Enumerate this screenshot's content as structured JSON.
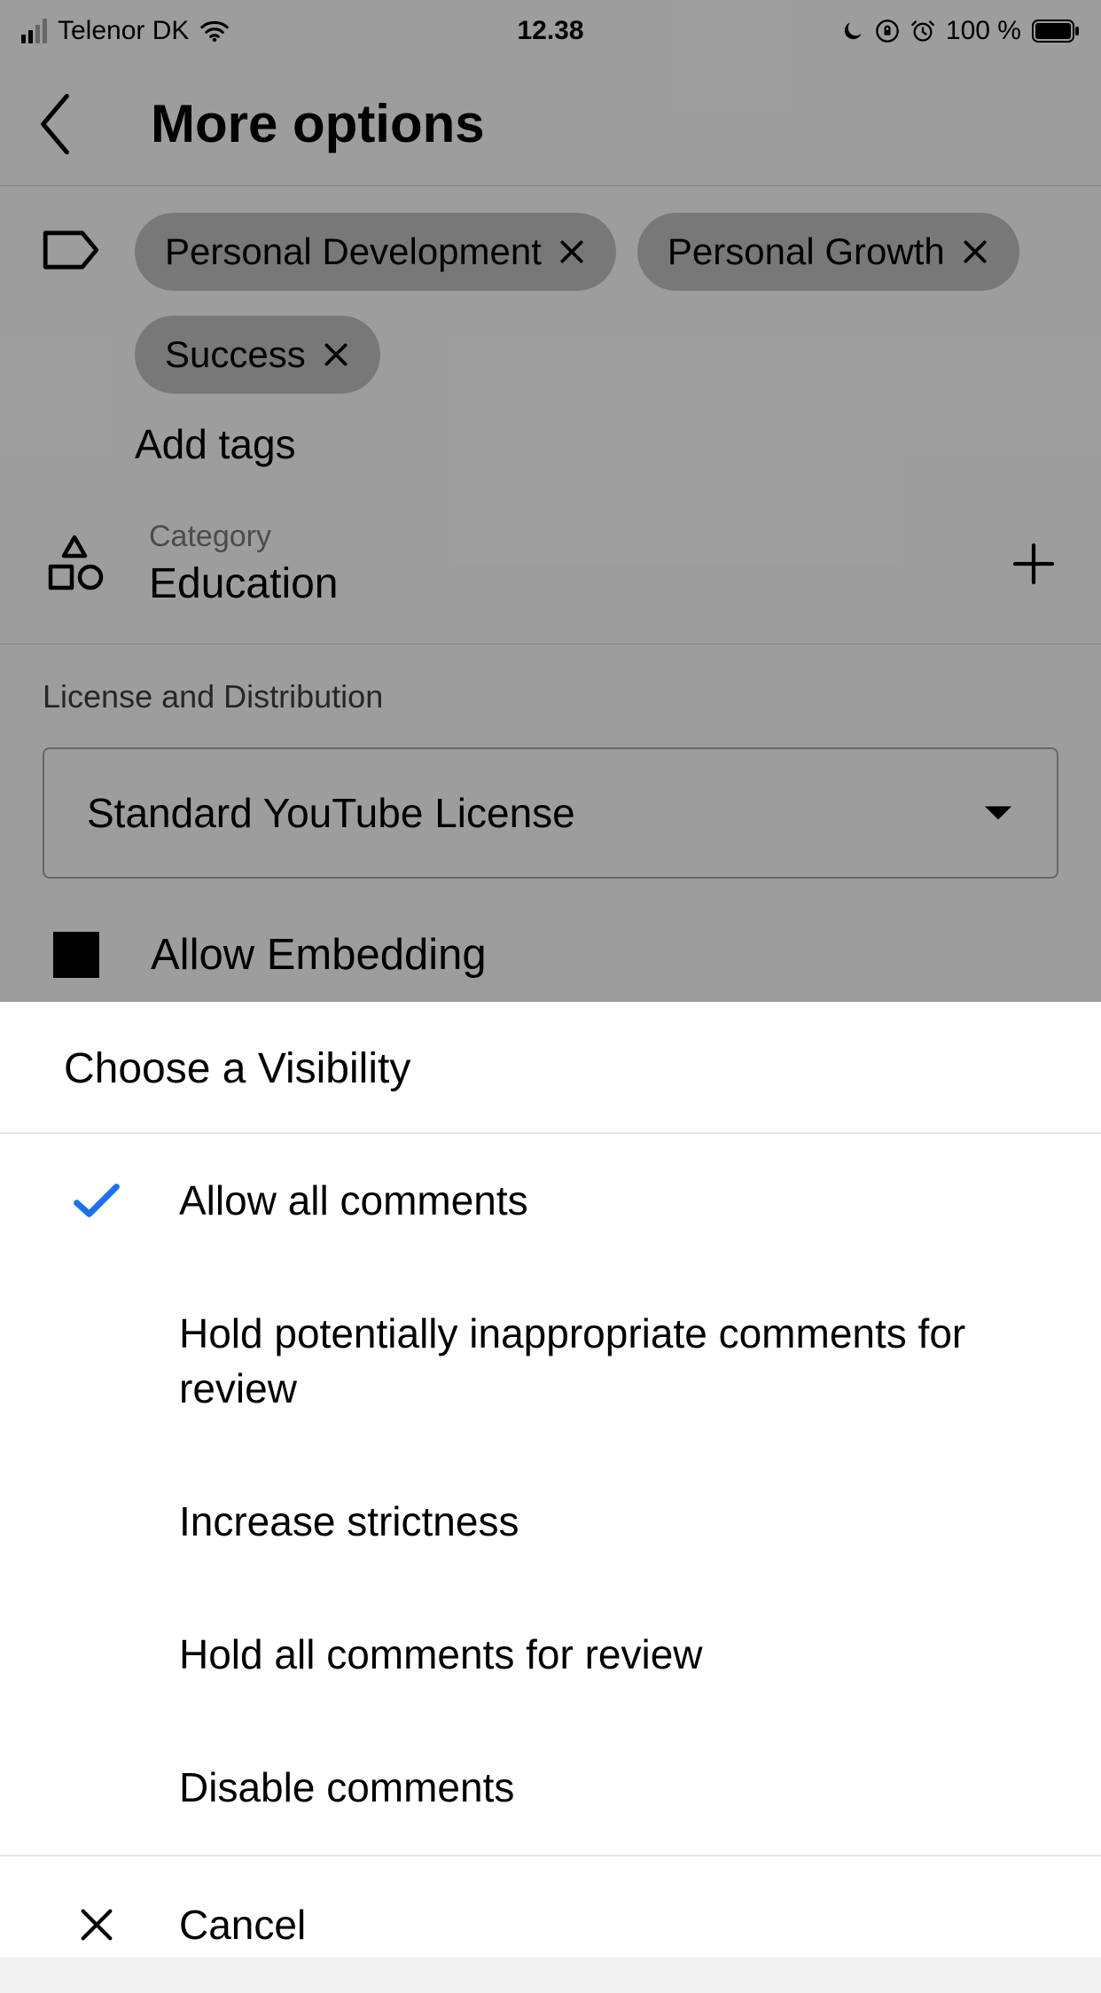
{
  "status": {
    "carrier": "Telenor DK",
    "time": "12.38",
    "battery": "100 %"
  },
  "header": {
    "title": "More options"
  },
  "tags": {
    "items": [
      {
        "label": "Personal Development"
      },
      {
        "label": "Personal Growth"
      },
      {
        "label": "Success"
      }
    ],
    "add_label": "Add tags"
  },
  "category": {
    "label": "Category",
    "value": "Education"
  },
  "license": {
    "section_label": "License and Distribution",
    "selected": "Standard YouTube License"
  },
  "allow_embedding": {
    "label": "Allow Embedding"
  },
  "sheet": {
    "title": "Choose a Visibility",
    "options": {
      "o0": "Allow all comments",
      "o1": "Hold potentially inappropriate comments for review",
      "o2": "Increase strictness",
      "o3": "Hold all comments for review",
      "o4": "Disable comments"
    },
    "cancel": "Cancel"
  }
}
